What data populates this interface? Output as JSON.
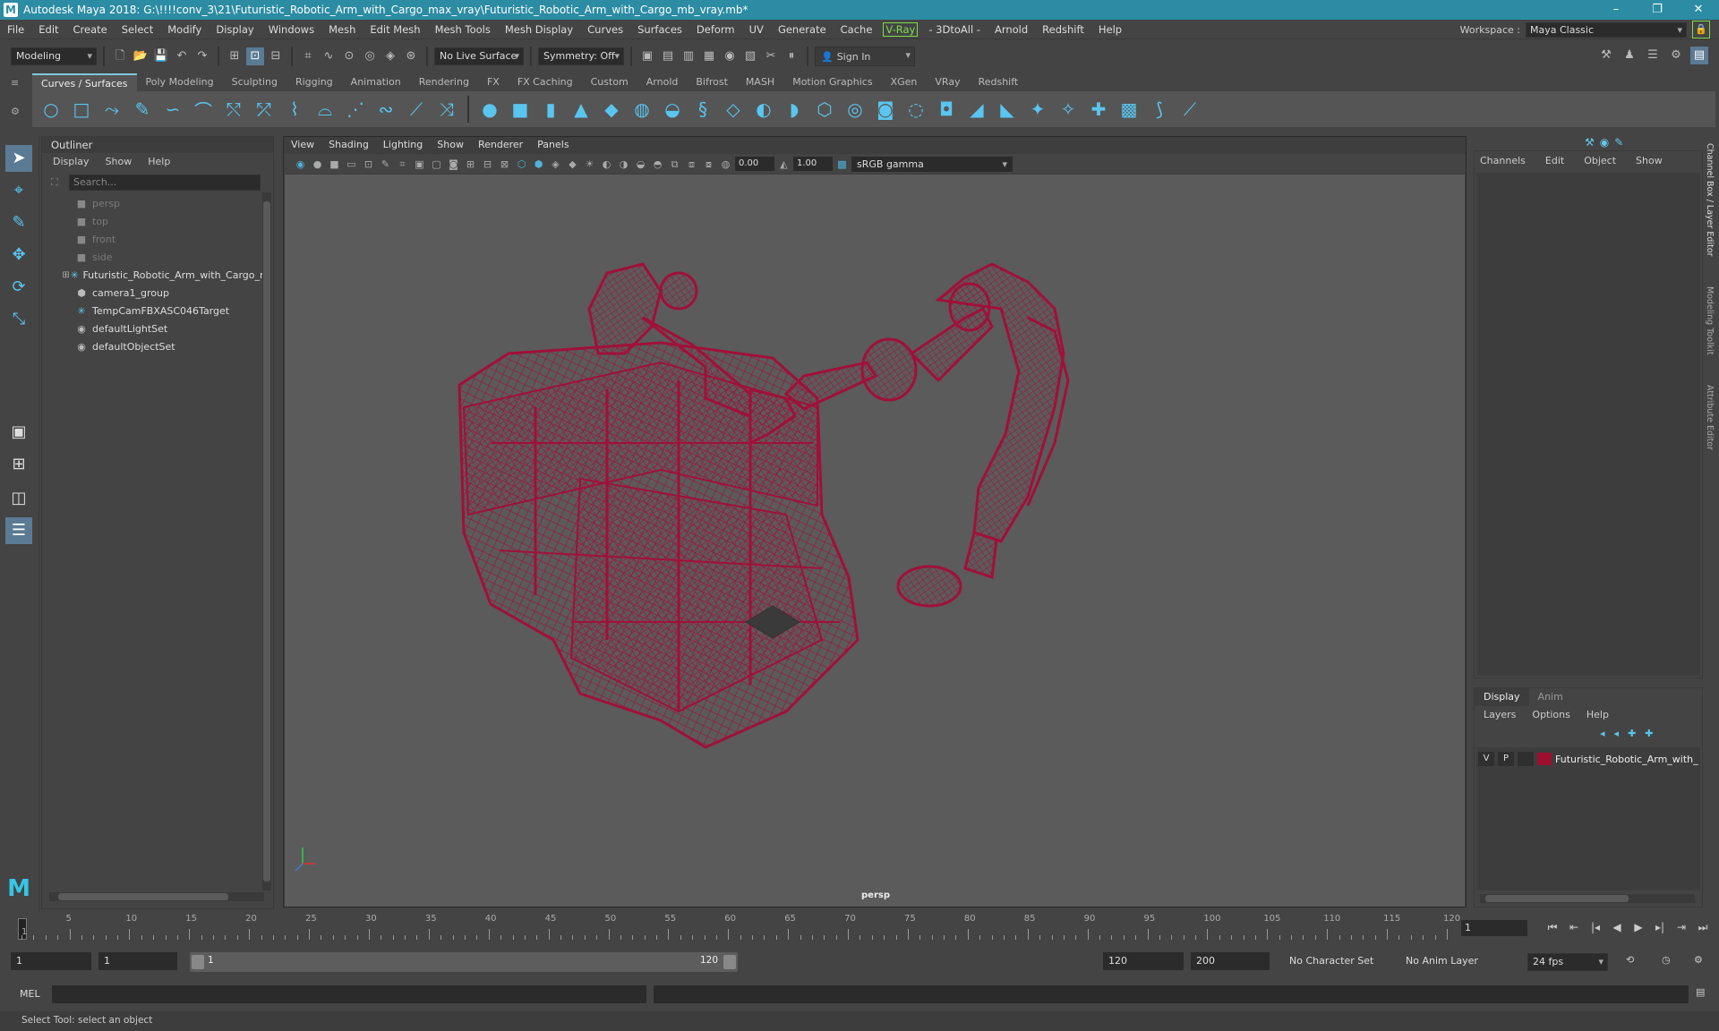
{
  "titlebar": {
    "logo": "M",
    "title": "Autodesk Maya 2018: G:\\!!!!conv_3\\21\\Futuristic_Robotic_Arm_with_Cargo_max_vray\\Futuristic_Robotic_Arm_with_Cargo_mb_vray.mb*",
    "minimize": "–",
    "restore": "❐",
    "close": "✕"
  },
  "menubar": {
    "items": [
      "File",
      "Edit",
      "Create",
      "Select",
      "Modify",
      "Display",
      "Windows",
      "Mesh",
      "Edit Mesh",
      "Mesh Tools",
      "Mesh Display",
      "Curves",
      "Surfaces",
      "Deform",
      "UV",
      "Generate",
      "Cache"
    ],
    "vray": "V-Ray",
    "items2": [
      "- 3DtoAll -",
      "Arnold",
      "Redshift",
      "Help"
    ],
    "workspace_label": "Workspace :",
    "workspace_value": "Maya Classic"
  },
  "statusline": {
    "mode": "Modeling",
    "live_surface": "No Live Surface",
    "symmetry": "Symmetry: Off",
    "signin": "Sign In"
  },
  "shelf": {
    "tabs": [
      "Curves / Surfaces",
      "Poly Modeling",
      "Sculpting",
      "Rigging",
      "Animation",
      "Rendering",
      "FX",
      "FX Caching",
      "Custom",
      "Arnold",
      "Bifrost",
      "MASH",
      "Motion Graphics",
      "XGen",
      "VRay",
      "Redshift"
    ],
    "active_tab": "Curves / Surfaces"
  },
  "outliner": {
    "title": "Outliner",
    "menu": [
      "Display",
      "Show",
      "Help"
    ],
    "search_placeholder": "Search...",
    "items": [
      {
        "label": "persp",
        "icon": "camera-icon",
        "dim": true
      },
      {
        "label": "top",
        "icon": "camera-icon",
        "dim": true
      },
      {
        "label": "front",
        "icon": "camera-icon",
        "dim": true
      },
      {
        "label": "side",
        "icon": "camera-icon",
        "dim": true
      },
      {
        "label": "Futuristic_Robotic_Arm_with_Cargo_n",
        "icon": "locator-icon",
        "expandable": true
      },
      {
        "label": "camera1_group",
        "icon": "group-icon"
      },
      {
        "label": "TempCamFBXASC046Target",
        "icon": "locator-icon"
      },
      {
        "label": "defaultLightSet",
        "icon": "set-icon"
      },
      {
        "label": "defaultObjectSet",
        "icon": "set-icon"
      }
    ]
  },
  "viewport": {
    "menu": [
      "View",
      "Shading",
      "Lighting",
      "Show",
      "Renderer",
      "Panels"
    ],
    "exposure": "0.00",
    "gamma_value": "1.00",
    "color_space": "sRGB gamma",
    "camera": "persp",
    "wire_color": "#a0103a"
  },
  "channelbox": {
    "menu": [
      "Channels",
      "Edit",
      "Object",
      "Show"
    ],
    "side_tabs": [
      "Channel Box / Layer Editor",
      "Modeling Toolkit",
      "Attribute Editor"
    ]
  },
  "layereditor": {
    "tabs": [
      "Display",
      "Anim"
    ],
    "menu": [
      "Layers",
      "Options",
      "Help"
    ],
    "layer": {
      "v": "V",
      "p": "P",
      "name": "Futuristic_Robotic_Arm_with_C",
      "color": "#9e0f2f"
    }
  },
  "timeline": {
    "labels": [
      "5",
      "10",
      "15",
      "20",
      "25",
      "30",
      "35",
      "40",
      "45",
      "50",
      "55",
      "60",
      "65",
      "70",
      "75",
      "80",
      "85",
      "90",
      "95",
      "100",
      "105",
      "110",
      "115",
      "120"
    ],
    "first_label": "1",
    "current_frame": "1"
  },
  "range": {
    "start": "1",
    "playback_start": "1",
    "range_start": "1",
    "range_end": "120",
    "playback_end": "120",
    "end": "200",
    "character_set": "No Character Set",
    "anim_layer": "No Anim Layer",
    "fps": "24 fps"
  },
  "cmdline": {
    "label": "MEL",
    "help": "Select Tool: select an object"
  }
}
